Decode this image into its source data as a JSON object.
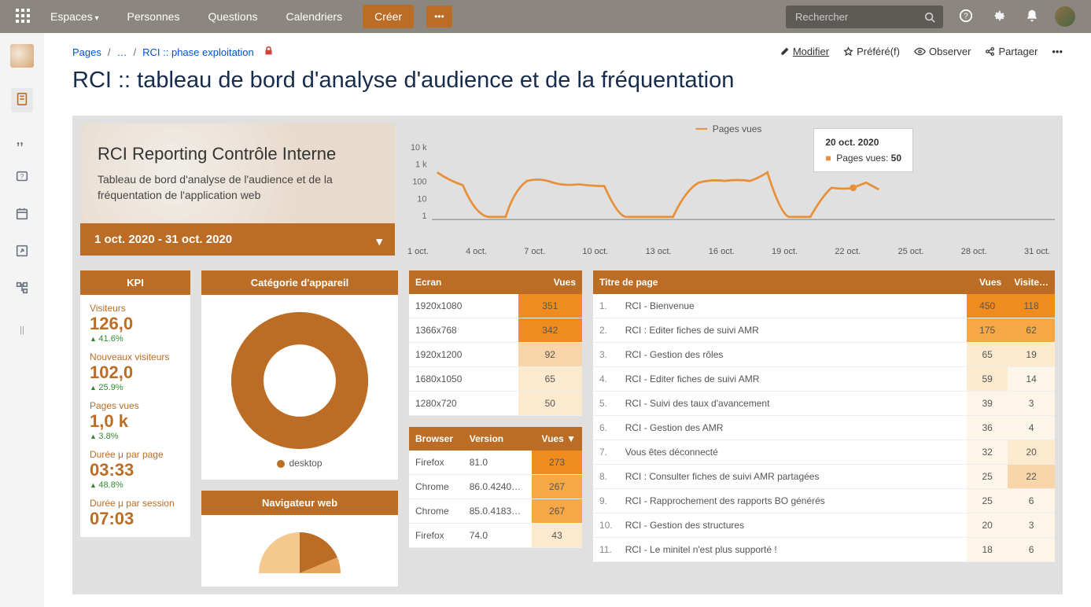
{
  "topbar": {
    "nav": [
      "Espaces",
      "Personnes",
      "Questions",
      "Calendriers"
    ],
    "create": "Créer",
    "search_placeholder": "Rechercher"
  },
  "breadcrumb": {
    "root": "Pages",
    "mid": "…",
    "leaf": "RCI :: phase exploitation"
  },
  "page_actions": {
    "edit": "Modifier",
    "fav": "Préféré(f)",
    "watch": "Observer",
    "share": "Partager"
  },
  "page_title": "RCI :: tableau de bord d'analyse d'audience et de la fréquentation",
  "intro": {
    "title": "RCI Reporting Contrôle Interne",
    "desc": "Tableau de bord d'analyse de l'audience et de la fréquentation de l'application web"
  },
  "date_range": "1 oct. 2020 - 31 oct. 2020",
  "chart_data": {
    "type": "line",
    "title": "Pages vues",
    "series_name": "Pages vues",
    "ylabel": "",
    "yscale": "log",
    "yticks": [
      "10 k",
      "1 k",
      "100",
      "10",
      "1"
    ],
    "categories": [
      "1 oct.",
      "4 oct.",
      "7 oct.",
      "10 oct.",
      "13 oct.",
      "16 oct.",
      "19 oct.",
      "22 oct.",
      "25 oct.",
      "28 oct.",
      "31 oct."
    ],
    "series": [
      {
        "name": "Pages vues",
        "x_days": [
          1,
          2,
          3,
          4,
          5,
          6,
          7,
          8,
          9,
          10,
          11,
          12,
          13,
          14,
          15,
          16,
          17,
          18,
          19,
          20,
          21,
          22
        ],
        "values": [
          300,
          80,
          1,
          1,
          100,
          150,
          100,
          100,
          1,
          1,
          1,
          100,
          120,
          150,
          130,
          250,
          1,
          1,
          60,
          50,
          80,
          50
        ]
      }
    ],
    "tooltip": {
      "date": "20 oct. 2020",
      "label": "Pages vues:",
      "value": "50"
    }
  },
  "kpi": {
    "header": "KPI",
    "items": [
      {
        "label": "Visiteurs",
        "value": "126,0",
        "delta": "41.6%"
      },
      {
        "label": "Nouveaux visiteurs",
        "value": "102,0",
        "delta": "25.9%"
      },
      {
        "label": "Pages vues",
        "value": "1,0 k",
        "delta": "3.8%"
      },
      {
        "label": "Durée μ par page",
        "value": "03:33",
        "delta": "48.8%"
      },
      {
        "label": "Durée μ par session",
        "value": "07:03",
        "delta": ""
      }
    ]
  },
  "device_cat": {
    "header": "Catégorie d'appareil",
    "center_label": "desktop",
    "legend": "desktop"
  },
  "browser_panel": {
    "header": "Navigateur web"
  },
  "screens": {
    "headers": [
      "Ecran",
      "Vues"
    ],
    "rows": [
      {
        "res": "1920x1080",
        "views": "351",
        "heat": "h1"
      },
      {
        "res": "1366x768",
        "views": "342",
        "heat": "h1"
      },
      {
        "res": "1920x1200",
        "views": "92",
        "heat": "h3"
      },
      {
        "res": "1680x1050",
        "views": "65",
        "heat": "h4"
      },
      {
        "res": "1280x720",
        "views": "50",
        "heat": "h4"
      }
    ]
  },
  "browsers": {
    "headers": [
      "Browser",
      "Version",
      "Vues ▼"
    ],
    "rows": [
      {
        "b": "Firefox",
        "v": "81.0",
        "views": "273",
        "heat": "h1"
      },
      {
        "b": "Chrome",
        "v": "86.0.4240…",
        "views": "267",
        "heat": "h2"
      },
      {
        "b": "Chrome",
        "v": "85.0.4183…",
        "views": "267",
        "heat": "h2"
      },
      {
        "b": "Firefox",
        "v": "74.0",
        "views": "43",
        "heat": "h4"
      }
    ]
  },
  "pages": {
    "headers": [
      "Titre de page",
      "Vues",
      "Visite…"
    ],
    "rows": [
      {
        "i": "1.",
        "t": "RCI - Bienvenue",
        "v": "450",
        "hv": "h1",
        "vi": "118",
        "hvi": "h1"
      },
      {
        "i": "2.",
        "t": "RCI : Editer fiches de suivi AMR",
        "v": "175",
        "hv": "h2",
        "vi": "62",
        "hvi": "h2"
      },
      {
        "i": "3.",
        "t": "RCI - Gestion des rôles",
        "v": "65",
        "hv": "h4",
        "vi": "19",
        "hvi": "h4"
      },
      {
        "i": "4.",
        "t": "RCI - Editer fiches de suivi AMR",
        "v": "59",
        "hv": "h4",
        "vi": "14",
        "hvi": "h5"
      },
      {
        "i": "5.",
        "t": "RCI - Suivi des taux d'avancement",
        "v": "39",
        "hv": "h5",
        "vi": "3",
        "hvi": "h5"
      },
      {
        "i": "6.",
        "t": "RCI - Gestion des AMR",
        "v": "36",
        "hv": "h5",
        "vi": "4",
        "hvi": "h5"
      },
      {
        "i": "7.",
        "t": "Vous êtes déconnecté",
        "v": "32",
        "hv": "h5",
        "vi": "20",
        "hvi": "h4"
      },
      {
        "i": "8.",
        "t": "RCI : Consulter fiches de suivi AMR partagées",
        "v": "25",
        "hv": "h5",
        "vi": "22",
        "hvi": "h3"
      },
      {
        "i": "9.",
        "t": "RCI - Rapprochement des rapports BO générés",
        "v": "25",
        "hv": "h5",
        "vi": "6",
        "hvi": "h5"
      },
      {
        "i": "10.",
        "t": "RCI - Gestion des structures",
        "v": "20",
        "hv": "h5",
        "vi": "3",
        "hvi": "h5"
      },
      {
        "i": "11.",
        "t": "RCI - Le minitel n'est plus supporté !",
        "v": "18",
        "hv": "h5",
        "vi": "6",
        "hvi": "h5"
      }
    ]
  }
}
